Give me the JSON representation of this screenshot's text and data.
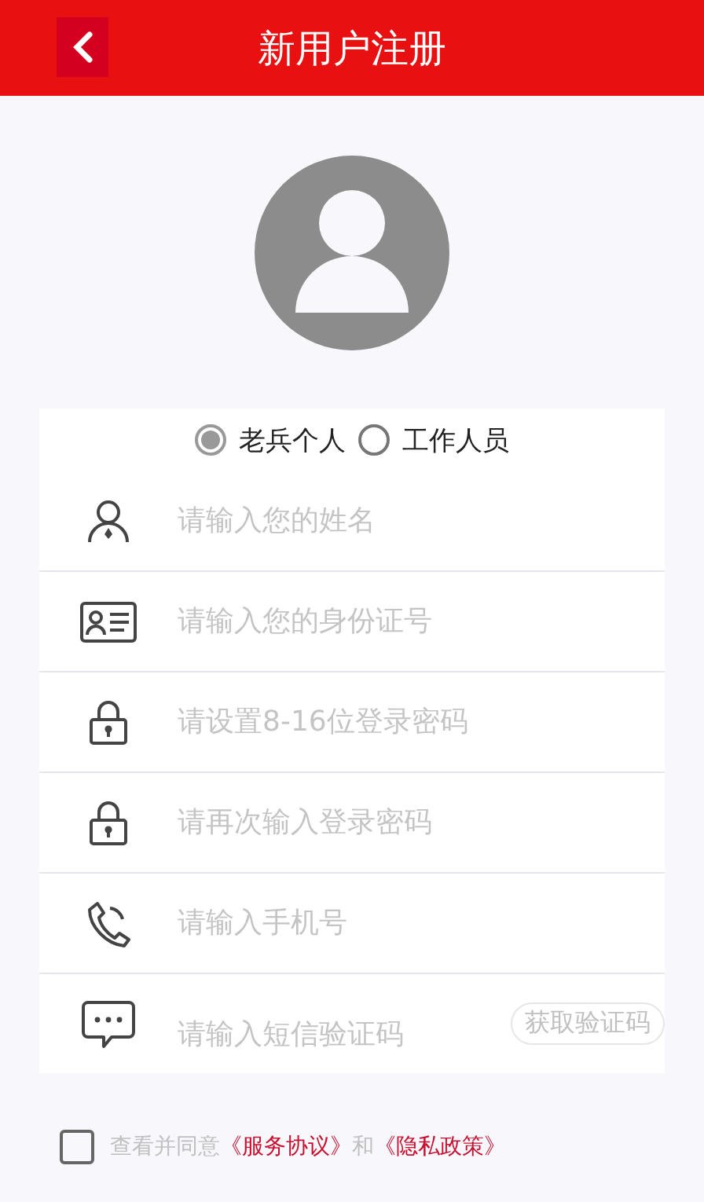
{
  "header": {
    "title": "新用户注册"
  },
  "user_types": [
    {
      "label": "老兵个人",
      "selected": true
    },
    {
      "label": "工作人员",
      "selected": false
    }
  ],
  "fields": [
    {
      "kind": "person",
      "placeholder": "请输入您的姓名"
    },
    {
      "kind": "id-card",
      "placeholder": "请输入您的身份证号"
    },
    {
      "kind": "lock",
      "placeholder": "请设置8-16位登录密码"
    },
    {
      "kind": "lock",
      "placeholder": "请再次输入登录密码"
    },
    {
      "kind": "phone",
      "placeholder": "请输入手机号"
    },
    {
      "kind": "chat",
      "placeholder": "请输入短信验证码",
      "button": "获取验证码"
    }
  ],
  "agreement": {
    "checked": false,
    "parts": [
      {
        "kind": "plain",
        "text": "查看并同意"
      },
      {
        "kind": "link",
        "text": "《服务协议》"
      },
      {
        "kind": "plain",
        "text": "和"
      },
      {
        "kind": "link",
        "text": "《隐私政策》"
      }
    ]
  }
}
